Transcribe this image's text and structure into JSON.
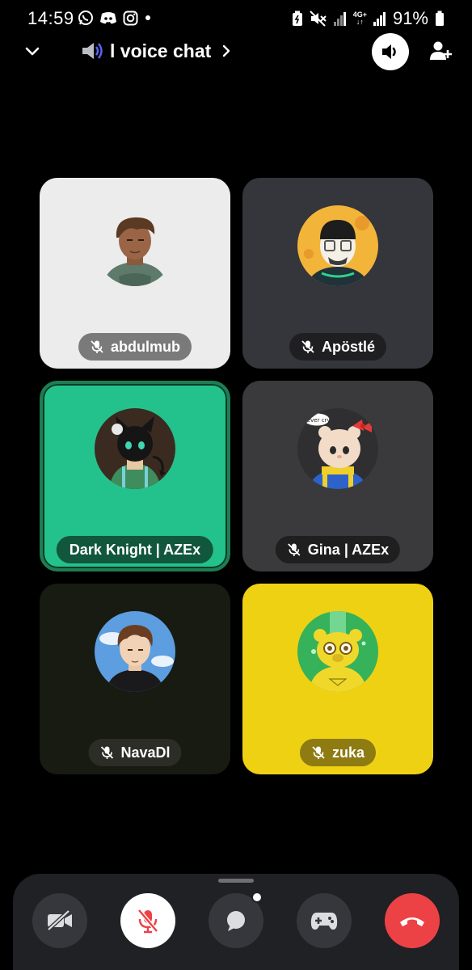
{
  "status_bar": {
    "time": "14:59",
    "network": "4G+",
    "battery": "91%",
    "left_icons": [
      "whatsapp-icon",
      "discord-icon",
      "instagram-icon",
      "dot-icon"
    ],
    "right_icons": [
      "battery-saver-icon",
      "mute-icon",
      "signal-icon",
      "signal-icon",
      "battery-icon"
    ]
  },
  "header": {
    "channel_icon": "speaker-icon",
    "title": "l voice chat",
    "collapse_icon": "chevron-down-icon",
    "title_chevron": "chevron-right-icon",
    "speaker_button_icon": "volume-icon",
    "invite_button_icon": "add-user-icon"
  },
  "participants": [
    {
      "name": "abdulmub",
      "muted": true,
      "speaking": false,
      "tile_color": "#ececec"
    },
    {
      "name": "Apöstlé",
      "muted": true,
      "speaking": false,
      "tile_color": "#35353c"
    },
    {
      "name": "Dark Knight | AZEx",
      "muted": false,
      "speaking": true,
      "tile_color": "#23c28c"
    },
    {
      "name": "Gina | AZEx",
      "muted": true,
      "speaking": false,
      "tile_color": "#3a3a3d"
    },
    {
      "name": "NavaDl",
      "muted": true,
      "speaking": false,
      "tile_color": "#181b12"
    },
    {
      "name": "zuka",
      "muted": true,
      "speaking": false,
      "tile_color": "#efd114"
    }
  ],
  "gina_avatar_text": "never cry",
  "controls": {
    "camera": "camera-off-icon",
    "microphone": "mic-off-icon",
    "chat": "chat-icon",
    "activities": "gamepad-icon",
    "end_call": "hang-up-icon",
    "end_call_color": "#ed4245"
  }
}
